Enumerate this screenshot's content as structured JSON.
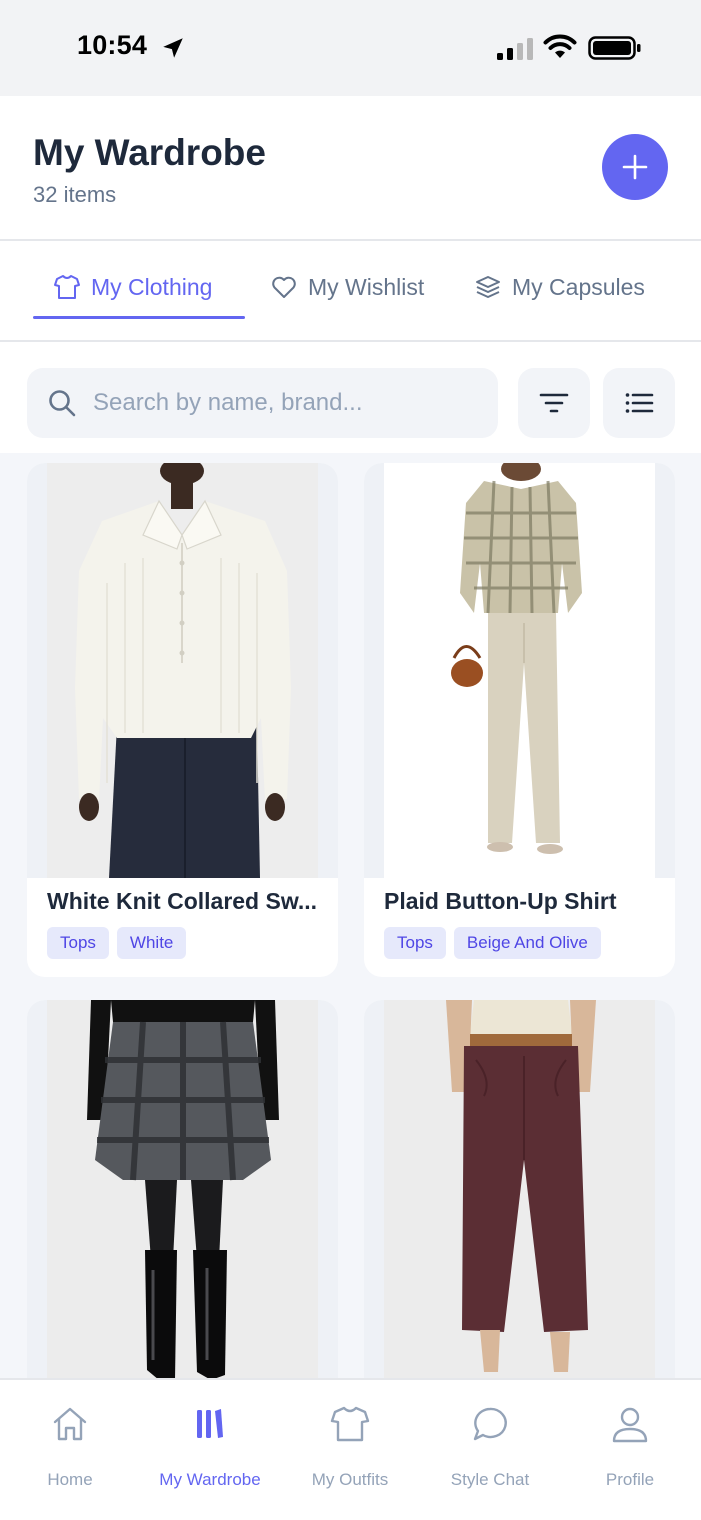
{
  "status_bar": {
    "time": "10:54"
  },
  "header": {
    "title": "My Wardrobe",
    "count": "32 items"
  },
  "tabs": [
    {
      "label": "My Clothing",
      "icon": "shirt-icon",
      "active": true
    },
    {
      "label": "My Wishlist",
      "icon": "heart-icon",
      "active": false
    },
    {
      "label": "My Capsules",
      "icon": "layers-icon",
      "active": false
    }
  ],
  "search": {
    "placeholder": "Search by name, brand...",
    "value": ""
  },
  "items": [
    {
      "title": "White Knit Collared Sw...",
      "tags": [
        "Tops",
        "White"
      ]
    },
    {
      "title": "Plaid Button-Up Shirt",
      "tags": [
        "Tops",
        "Beige And Olive"
      ]
    },
    {
      "title": "",
      "tags": []
    },
    {
      "title": "",
      "tags": []
    }
  ],
  "bottom_nav": [
    {
      "label": "Home",
      "icon": "home-icon",
      "active": false
    },
    {
      "label": "My Wardrobe",
      "icon": "wardrobe-icon",
      "active": true
    },
    {
      "label": "My Outfits",
      "icon": "shirt-icon",
      "active": false
    },
    {
      "label": "Style Chat",
      "icon": "chat-icon",
      "active": false
    },
    {
      "label": "Profile",
      "icon": "profile-icon",
      "active": false
    }
  ],
  "colors": {
    "accent": "#6366f1",
    "text": "#1e293b",
    "muted": "#64748b",
    "tag_bg": "#e6e9fb"
  }
}
